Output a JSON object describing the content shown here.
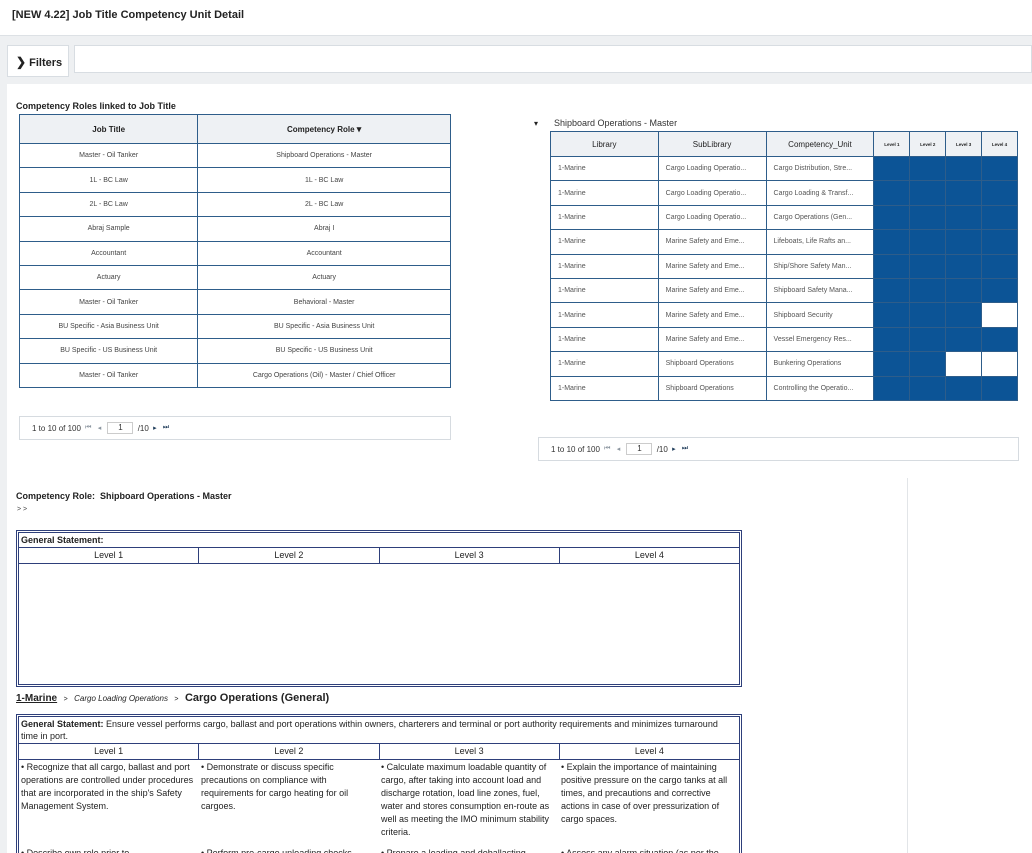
{
  "window": {
    "title": "[NEW 4.22] Job Title Competency Unit Detail"
  },
  "filters": {
    "label": "Filters"
  },
  "roles_section": {
    "label": "Competency Roles linked to Job Title",
    "columns": {
      "job_title": "Job Title",
      "competency_role": "Competency Role"
    },
    "rows": [
      {
        "job_title": "Master - Oil Tanker",
        "competency_role": "Shipboard Operations - Master"
      },
      {
        "job_title": "1L - BC Law",
        "competency_role": "1L - BC Law"
      },
      {
        "job_title": "2L - BC Law",
        "competency_role": "2L - BC Law"
      },
      {
        "job_title": "Abraj Sample",
        "competency_role": "Abraj I"
      },
      {
        "job_title": "Accountant",
        "competency_role": "Accountant"
      },
      {
        "job_title": "Actuary",
        "competency_role": "Actuary"
      },
      {
        "job_title": "Master - Oil Tanker",
        "competency_role": "Behavioral - Master"
      },
      {
        "job_title": "BU Specific - Asia Business Unit",
        "competency_role": "BU Specific - Asia Business Unit"
      },
      {
        "job_title": "BU Specific - US Business Unit",
        "competency_role": "BU Specific - US Business Unit"
      },
      {
        "job_title": "Master - Oil Tanker",
        "competency_role": "Cargo Operations (Oil) - Master / Chief Officer"
      }
    ],
    "pager": {
      "range": "1 to 10 of 100",
      "page": "1",
      "total": "/10"
    }
  },
  "units_section": {
    "title": "Shipboard Operations - Master",
    "columns": {
      "library": "Library",
      "sublibrary": "SubLibrary",
      "unit": "Competency_Unit",
      "level1": "Level 1",
      "level2": "Level 2",
      "level3": "Level 3",
      "level4": "Level 4"
    },
    "rows": [
      {
        "library": "1-Marine",
        "sublibrary": "Cargo Loading Operatio...",
        "unit": "Cargo Distribution, Stre...",
        "levels": [
          1,
          1,
          1,
          1
        ]
      },
      {
        "library": "1-Marine",
        "sublibrary": "Cargo Loading Operatio...",
        "unit": "Cargo Loading & Transf...",
        "levels": [
          1,
          1,
          1,
          1
        ]
      },
      {
        "library": "1-Marine",
        "sublibrary": "Cargo Loading Operatio...",
        "unit": "Cargo Operations (Gen...",
        "levels": [
          1,
          1,
          1,
          1
        ]
      },
      {
        "library": "1-Marine",
        "sublibrary": "Marine Safety and Eme...",
        "unit": "Lifeboats, Life Rafts an...",
        "levels": [
          1,
          1,
          1,
          1
        ]
      },
      {
        "library": "1-Marine",
        "sublibrary": "Marine Safety and Eme...",
        "unit": "Ship/Shore Safety Man...",
        "levels": [
          1,
          1,
          1,
          1
        ]
      },
      {
        "library": "1-Marine",
        "sublibrary": "Marine Safety and Eme...",
        "unit": "Shipboard Safety Mana...",
        "levels": [
          1,
          1,
          1,
          1
        ]
      },
      {
        "library": "1-Marine",
        "sublibrary": "Marine Safety and Eme...",
        "unit": "Shipboard Security",
        "levels": [
          1,
          1,
          1,
          0
        ]
      },
      {
        "library": "1-Marine",
        "sublibrary": "Marine Safety and Eme...",
        "unit": "Vessel Emergency Res...",
        "levels": [
          1,
          1,
          1,
          1
        ]
      },
      {
        "library": "1-Marine",
        "sublibrary": "Shipboard Operations",
        "unit": "Bunkering Operations",
        "levels": [
          1,
          1,
          0,
          0
        ]
      },
      {
        "library": "1-Marine",
        "sublibrary": "Shipboard Operations",
        "unit": "Controlling the Operatio...",
        "levels": [
          1,
          1,
          1,
          1
        ]
      }
    ],
    "level_colors": {
      "on": "#0c5496",
      "off": "#ffffff"
    },
    "pager": {
      "range": "1 to 10 of 100",
      "page": "1",
      "total": "/10"
    }
  },
  "role_detail": {
    "label": "Competency Role:",
    "role_name": "Shipboard Operations - Master",
    "crumb": "> >",
    "general_label": "General Statement:",
    "levels": [
      "Level 1",
      "Level 2",
      "Level 3",
      "Level 4"
    ]
  },
  "unit_detail": {
    "breadcrumb": {
      "library": "1-Marine",
      "sublibrary": "Cargo Loading Operations",
      "unit": "Cargo Operations (General)",
      "sep": ">"
    },
    "general_label": "General Statement:",
    "general_text": " Ensure vessel performs cargo, ballast and port operations within owners, charterers and terminal or port authority requirements and minimizes turnaround time in port.",
    "levels": [
      "Level 1",
      "Level 2",
      "Level 3",
      "Level 4"
    ],
    "descriptions": [
      "• Recognize that all cargo, ballast and port operations are controlled under procedures that are incorporated in the ship's Safety Management System.",
      "• Demonstrate or discuss specific precautions on compliance with requirements for cargo heating for oil cargoes.",
      "• Calculate maximum loadable quantity of cargo, after taking into account load and discharge rotation, load line zones, fuel, water and stores consumption en-route as well as meeting the IMO minimum stability criteria.",
      "• Explain the importance of maintaining positive pressure on the cargo tanks at all times, and precautions and corrective actions in case of over pressurization of cargo spaces."
    ],
    "descriptions_next": [
      "• Describe own role prior to",
      "• Perform pre-cargo unloading checks",
      "• Prepare a loading and deballasting",
      "• Assess any alarm situation (as per the"
    ]
  },
  "icons": {
    "chevron": "chevron-right-icon",
    "sort": "chevron-down-icon",
    "expander": "caret-down-icon"
  }
}
